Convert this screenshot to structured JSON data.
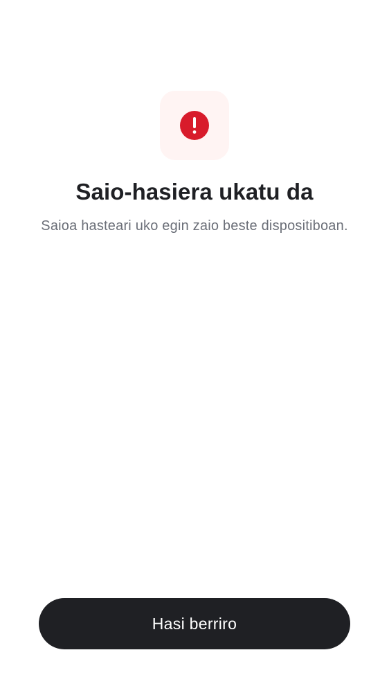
{
  "status_icon": {
    "name": "error-alert-icon",
    "background_color": "#fff4f3",
    "icon_color": "#d81b2b"
  },
  "header": {
    "title": "Saio-hasiera ukatu da",
    "subtitle": "Saioa hasteari uko egin zaio beste dispositiboan."
  },
  "actions": {
    "restart_label": "Hasi berriro",
    "button_color": "#1f2024"
  }
}
